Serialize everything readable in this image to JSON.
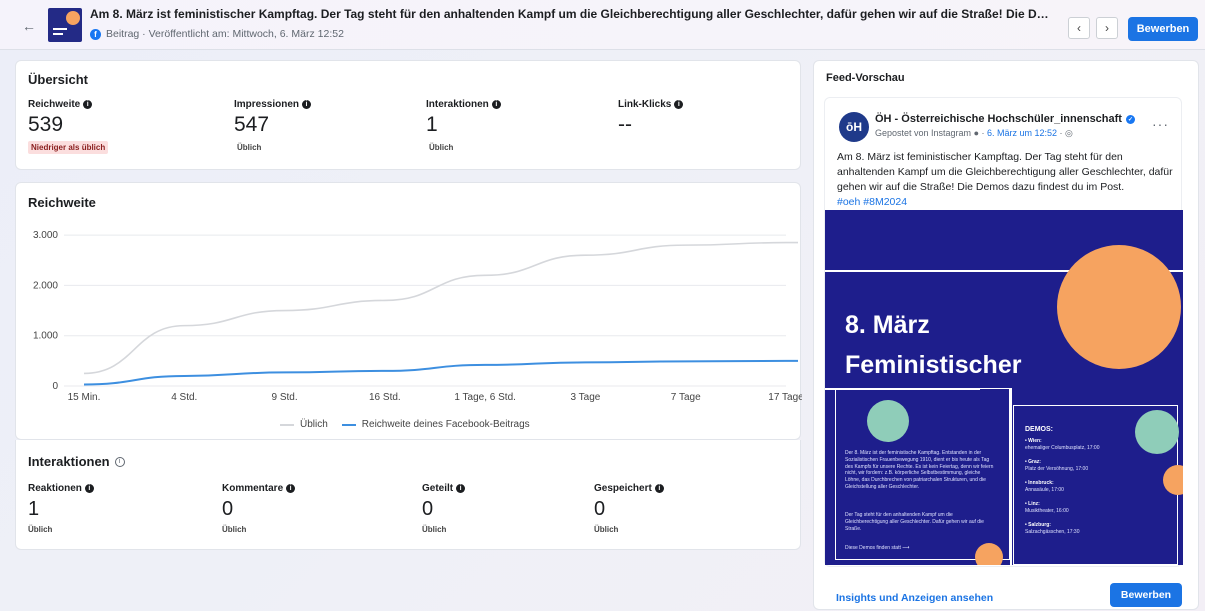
{
  "header": {
    "title": "Am 8. März ist feministischer Kampftag. Der Tag steht für den anhaltenden Kampf um die Gleichberechtigung aller Geschlechter, dafür gehen wir auf die Straße! Die Demos da...",
    "subline": "Beitrag · Veröffentlicht am: Mittwoch, 6. März 12:52",
    "prev_icon": "chevron-left-icon",
    "next_icon": "chevron-right-icon",
    "boost_label": "Bewerben"
  },
  "overview": {
    "title": "Übersicht",
    "metrics": [
      {
        "label": "Reichweite",
        "value": "539",
        "badge": "Niedriger als üblich"
      },
      {
        "label": "Impressionen",
        "value": "547",
        "badge": "Üblich"
      },
      {
        "label": "Interaktionen",
        "value": "1",
        "badge": "Üblich"
      },
      {
        "label": "Link-Klicks",
        "value": "--",
        "badge": ""
      }
    ]
  },
  "reach": {
    "title": "Reichweite",
    "legend": [
      "Üblich",
      "Reichweite deines Facebook-Beitrags"
    ]
  },
  "chart_data": {
    "type": "line",
    "title": "Reichweite",
    "categories": [
      "15 Min.",
      "4 Std.",
      "9 Std.",
      "16 Std.",
      "1 Tage, 6 Std.",
      "3 Tage",
      "7 Tage",
      "17 Tage"
    ],
    "yticks": [
      "0",
      "1.000",
      "2.000",
      "3.000"
    ],
    "ylim": [
      0,
      3200
    ],
    "grid": true,
    "legend_position": "bottom",
    "series": [
      {
        "name": "Üblich",
        "color": "#d5d7db",
        "values": [
          250,
          1200,
          1500,
          1700,
          2200,
          2600,
          2800,
          2850
        ]
      },
      {
        "name": "Reichweite deines Facebook-Beitrags",
        "color": "#3d8fe0",
        "values": [
          30,
          200,
          270,
          300,
          420,
          470,
          490,
          500
        ]
      }
    ]
  },
  "interactions": {
    "title": "Interaktionen",
    "metrics": [
      {
        "label": "Reaktionen",
        "value": "1",
        "sub": "Üblich"
      },
      {
        "label": "Kommentare",
        "value": "0",
        "sub": "Üblich"
      },
      {
        "label": "Geteilt",
        "value": "0",
        "sub": "Üblich"
      },
      {
        "label": "Gespeichert",
        "value": "0",
        "sub": "Üblich"
      }
    ]
  },
  "preview": {
    "title": "Feed-Vorschau",
    "page_logo": "ōH",
    "page_name": "ÖH - Österreichische Hochschüler_innenschaft",
    "posted_prefix": "Gepostet von Instagram",
    "posted_date": "6. März um 12:52",
    "post_text": "Am 8. März ist feministischer Kampftag. Der Tag steht für den anhaltenden Kampf um die Gleichberechtigung aller Geschlechter, dafür gehen wir auf die Straße! Die Demos dazu findest du im Post.",
    "hashtags": "#oeh #8M2024",
    "image_title_1": "8. März",
    "image_title_2": "Feministischer",
    "image_paragraph": "Der 8. März ist der feministische Kampftag. Entstanden in der Sozialistischen Frauenbewegung 1910, dient er bis heute als Tag des Kampfs für unsere Rechte. Es ist kein Feiertag, denn wir feiern nicht, wir fordern: z.B. körperliche Selbstbestimmung, gleiche Löhne, das Durchbrechen von patriarchalen Strukturen, und die Gleichstellung aller Geschlechter.",
    "image_paragraph_2": "Der Tag steht für den anhaltenden Kampf um die Gleichberechtigung aller Geschlechter. Dafür gehen wir auf die Straße.",
    "image_footer": "Diese Demos finden statt ⟶",
    "demos_title": "DEMOS:",
    "demos": [
      {
        "city": "• Wien:",
        "place": "ehemaliger Columbusplatz, 17:00"
      },
      {
        "city": "• Graz:",
        "place": "Platz der Versöhnung, 17:00"
      },
      {
        "city": "• Innsbruck:",
        "place": "Annasäule, 17:00"
      },
      {
        "city": "• Linz:",
        "place": "Musiktheater, 16:00"
      },
      {
        "city": "• Salzburg:",
        "place": "Salzachgässchen, 17:30"
      }
    ],
    "footer_link": "Insights und Anzeigen ansehen",
    "boost_label": "Bewerben"
  }
}
